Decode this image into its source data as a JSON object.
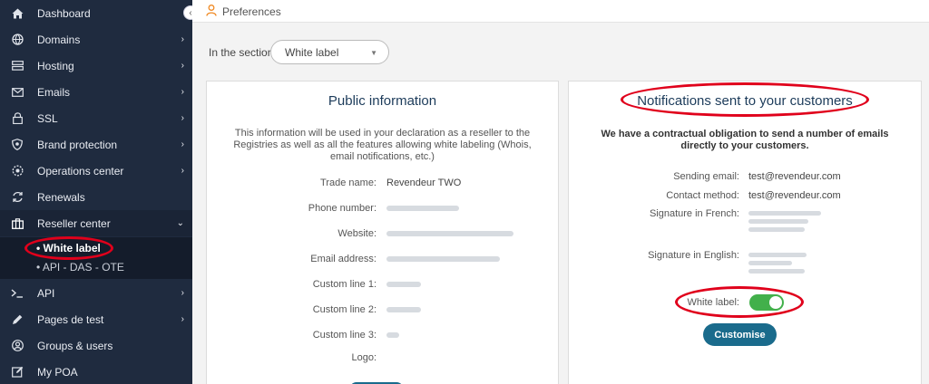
{
  "sidebar": {
    "items": [
      {
        "label": "Dashboard",
        "icon": "dashboard-icon",
        "chevron": ""
      },
      {
        "label": "Domains",
        "icon": "globe-icon",
        "chevron": "›"
      },
      {
        "label": "Hosting",
        "icon": "server-icon",
        "chevron": "›"
      },
      {
        "label": "Emails",
        "icon": "envelope-icon",
        "chevron": "›"
      },
      {
        "label": "SSL",
        "icon": "lock-icon",
        "chevron": "›"
      },
      {
        "label": "Brand protection",
        "icon": "shield-icon",
        "chevron": "›"
      },
      {
        "label": "Operations center",
        "icon": "gear-icon",
        "chevron": "›"
      },
      {
        "label": "Renewals",
        "icon": "refresh-icon",
        "chevron": ""
      },
      {
        "label": "Reseller center",
        "icon": "briefcase-icon",
        "chevron": "⌄"
      },
      {
        "label": "API",
        "icon": "terminal-icon",
        "chevron": "›"
      },
      {
        "label": "Pages de test",
        "icon": "pencil-icon",
        "chevron": "›"
      },
      {
        "label": "Groups & users",
        "icon": "users-icon",
        "chevron": ""
      },
      {
        "label": "My POA",
        "icon": "edit-icon",
        "chevron": ""
      }
    ],
    "submenu": [
      {
        "label": "• White label"
      },
      {
        "label": "• API - DAS - OTE"
      }
    ],
    "collapse_glyph": "‹"
  },
  "topbar": {
    "title": "Preferences"
  },
  "section": {
    "label": "In the section",
    "value": "White label",
    "arrow": "▼"
  },
  "public_info": {
    "title": "Public information",
    "intro": "This information will be used in your declaration as a reseller to the Registries as well as all the features allowing white labeling (Whois, email notifications, etc.)",
    "rows": [
      {
        "key": "Trade name:",
        "value": "Revendeur TWO"
      },
      {
        "key": "Phone number:",
        "value": ""
      },
      {
        "key": "Website:",
        "value": ""
      },
      {
        "key": "Email address:",
        "value": ""
      },
      {
        "key": "Custom line 1:",
        "value": ""
      },
      {
        "key": "Custom line 2:",
        "value": ""
      },
      {
        "key": "Custom line 3:",
        "value": ""
      },
      {
        "key": "Logo:",
        "value": ""
      }
    ]
  },
  "notifications": {
    "title": "Notifications sent to your customers",
    "intro": "We have a contractual obligation to send a number of emails directly to your customers.",
    "sending_email_label": "Sending email:",
    "sending_email_value": "test@revendeur.com",
    "contact_method_label": "Contact method:",
    "contact_method_value": "test@revendeur.com",
    "signature_fr_label": "Signature in French:",
    "signature_en_label": "Signature in English:",
    "white_label_label": "White label:",
    "white_label_enabled": true,
    "customise_label": "Customise"
  },
  "colors": {
    "sidebar_bg": "#1f2b3f",
    "accent": "#1a6b8c",
    "toggle_on": "#42b04b",
    "annotation": "#e0001b",
    "title": "#1c3b5a"
  }
}
